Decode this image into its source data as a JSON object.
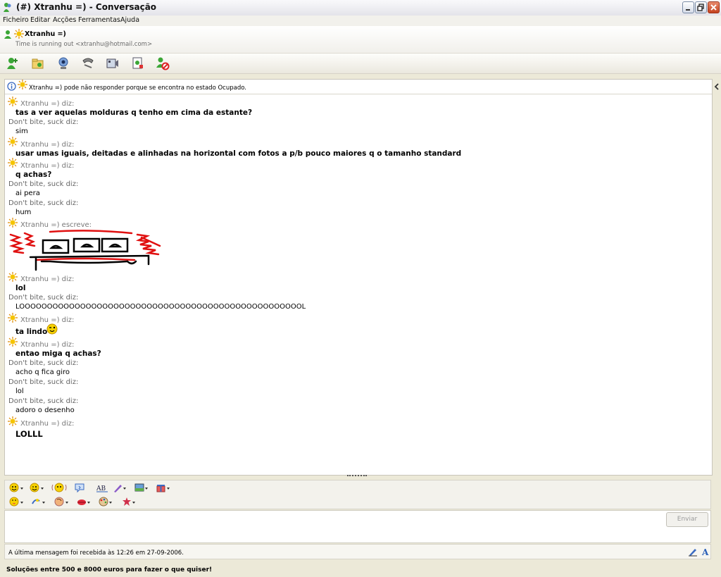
{
  "window": {
    "title": "(#) Xtranhu =) - Conversação"
  },
  "menu": [
    "Ficheiro",
    "Editar",
    "Acções",
    "Ferramentas",
    "Ajuda"
  ],
  "contact": {
    "name": "Xtranhu =)",
    "subtitle": "Time is running out <xtranhu@hotmail.com>"
  },
  "toolbar": [
    "invite-contact-icon",
    "send-files-icon",
    "webcam-icon",
    "call-icon",
    "video-icon",
    "activities-icon",
    "block-icon"
  ],
  "info": "Xtranhu =) pode não responder porque se encontra no estado Ocupado.",
  "messages": [
    {
      "who": "Xtranhu =) diz:",
      "text": "tas a ver aquelas molduras q tenho em cima da estante?"
    },
    {
      "who": "Don't bite, suck diz:",
      "text": "sim"
    },
    {
      "who": "Xtranhu =) diz:",
      "text": "usar umas iguais, deitadas e alinhadas na horizontal com fotos a p/b pouco maiores  q o tamanho standard"
    },
    {
      "who": "Xtranhu =) diz:",
      "text": "q achas?"
    },
    {
      "who": "Don't bite, suck diz:",
      "text": "ai pera"
    },
    {
      "who": "Don't bite, suck diz:",
      "text": "hum"
    },
    {
      "who": "Xtranhu =) escreve:",
      "text": ""
    },
    {
      "who": "Xtranhu =) diz:",
      "text": "lol"
    },
    {
      "who": "Don't bite, suck diz:",
      "text": "LOOOOOOOOOOOOOOOOOOOOOOOOOOOOOOOOOOOOOOOOOOOOOOOOOOOL"
    },
    {
      "who": "Xtranhu =) diz:",
      "text": "ta lindo"
    },
    {
      "who": "Xtranhu =) diz:",
      "text": "entao miga q achas?"
    },
    {
      "who": "Don't bite, suck diz:",
      "text": "acho q fica giro"
    },
    {
      "who": "Don't bite, suck diz:",
      "text": "lol"
    },
    {
      "who": "Don't bite, suck diz:",
      "text": "adoro o desenho"
    },
    {
      "who": "Xtranhu =) diz:",
      "text": "LOLLL"
    }
  ],
  "send_button": "Enviar",
  "status": "A última mensagem foi recebida às 12:26 em 27-09-2006.",
  "ad": "Soluções entre 500 e 8000 euros para fazer o que quiser!",
  "colors": {
    "drawing_red": "#e01010",
    "drawing_black": "#000000",
    "chrome": "#ece9d8"
  }
}
